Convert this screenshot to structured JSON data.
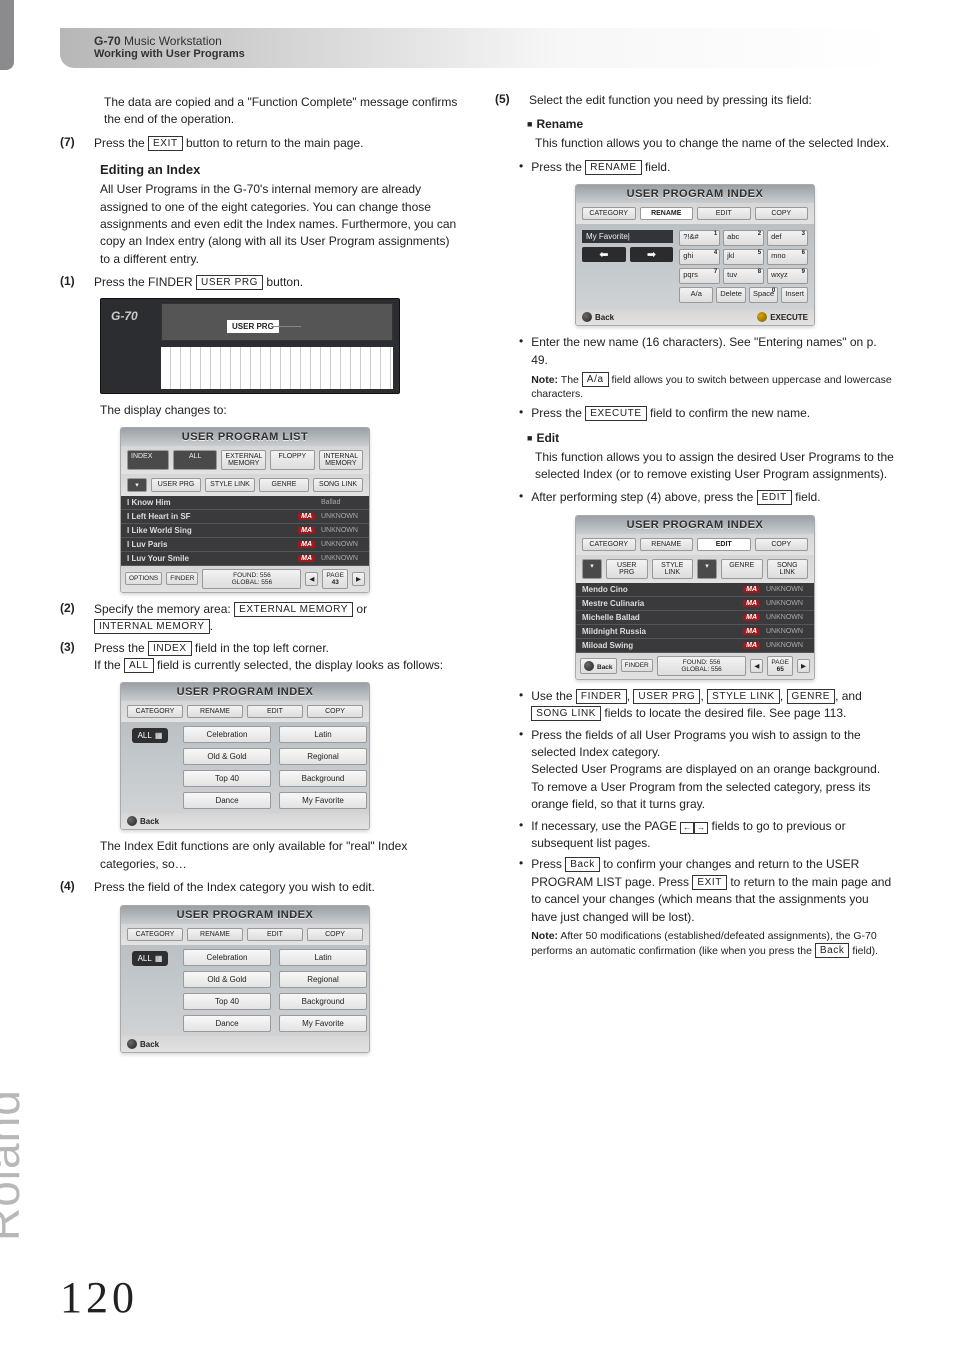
{
  "header": {
    "product_bold": "G-70",
    "product_rest": " Music Workstation",
    "subtitle": "Working with User Programs"
  },
  "brand": "Roland",
  "page_number": "120",
  "figs": {
    "device": {
      "callout": "USER PRG",
      "model": "G-70"
    },
    "list": {
      "title": "USER PROGRAM LIST",
      "top_tabs": [
        "ALL",
        "EXTERNAL MEMORY",
        "FLOPPY",
        "INTERNAL MEMORY"
      ],
      "sort_tabs": [
        "USER PRG",
        "STYLE LINK",
        "GENRE",
        "SONG LINK"
      ],
      "rows": [
        "I Know Him",
        "I Left Heart in SF",
        "I Like World Sing",
        "I Luv Paris",
        "I Luv Your Smile"
      ],
      "row_meta": "UNKNOWN",
      "row_meta0": "Ballad",
      "foot": [
        "OPTIONS",
        "FINDER",
        "FOUND: 556",
        "GLOBAL: 556"
      ],
      "page_label": "PAGE",
      "page_num": "43"
    },
    "index": {
      "title": "USER PROGRAM INDEX",
      "tabs": [
        "CATEGORY",
        "RENAME",
        "EDIT",
        "COPY"
      ],
      "all": "ALL",
      "cells": [
        "Celebration",
        "Latin",
        "Old & Gold",
        "Regional",
        "Top 40",
        "Background",
        "Dance",
        "My Favorite"
      ],
      "back": "Back"
    },
    "rename": {
      "title": "USER PROGRAM INDEX",
      "tabs": [
        "CATEGORY",
        "RENAME",
        "EDIT",
        "COPY"
      ],
      "field": "My   Favorite|",
      "keys": [
        "?!&# 1",
        "abc 2",
        "def 3",
        "ghi 4",
        "jkl 5",
        "mno 6",
        "pqrs 7",
        "tuv 8",
        "wxyz 9",
        "Delete",
        "Space 0",
        "Insert"
      ],
      "aa": "A/a",
      "back": "Back",
      "execute": "EXECUTE"
    },
    "edit": {
      "title": "USER PROGRAM INDEX",
      "tabs": [
        "CATEGORY",
        "RENAME",
        "EDIT",
        "COPY"
      ],
      "sort_tabs": [
        "USER PRG",
        "STYLE LINK",
        "GENRE",
        "SONG LINK"
      ],
      "rows": [
        "Mendo Cino",
        "Mestre Culinaria",
        "Michelle Ballad",
        "Mildnight Russia",
        "Miload Swing"
      ],
      "row_meta": "UNKNOWN",
      "foot": [
        "Back",
        "FINDER",
        "FOUND: 556",
        "GLOBAL: 556"
      ],
      "page_label": "PAGE",
      "page_num": "65"
    }
  },
  "left": {
    "p1": "The data are copied and a \"Function Complete\" message confirms the end of the operation.",
    "s7_num": "(7)",
    "s7a": "Press the ",
    "s7_btn": "EXIT",
    "s7b": " button to return to the main page.",
    "h_editing": "Editing an Index",
    "p2": "All User Programs in the G-70's internal memory are already assigned to one of the eight categories. You can change those assignments and even edit the Index names. Furthermore, you can copy an Index entry (along with all its User Program assignments) to a different entry.",
    "s1_num": "(1)",
    "s1a": "Press the FINDER ",
    "s1_btn": "USER PRG",
    "s1b": " button.",
    "p3": "The display changes to:",
    "s2_num": "(2)",
    "s2a": "Specify the memory area: ",
    "s2_btn1": "EXTERNAL MEMORY",
    "s2_mid": " or ",
    "s2_btn2": "INTERNAL MEMORY",
    "s2_end": ".",
    "s3_num": "(3)",
    "s3a": "Press the ",
    "s3_btn": "INDEX",
    "s3b": " field in the top left corner.",
    "s3c_a": "If the ",
    "s3c_btn": "ALL",
    "s3c_b": " field is currently selected, the display looks as follows:",
    "p4": "The Index Edit functions are only available for \"real\" Index categories, so…",
    "s4_num": "(4)",
    "s4": "Press the field of the Index category you wish to edit."
  },
  "right": {
    "s5_num": "(5)",
    "s5": "Select the edit function you need by pressing its field:",
    "h_rename": "Rename",
    "p_rename": "This function allows you to change the name of the selected Index.",
    "b_rename_a": "Press the ",
    "b_rename_btn": "RENAME",
    "b_rename_b": " field.",
    "b_enter": "Enter the new name (16 characters). See \"Entering names\" on p. 49.",
    "note1_label": "Note:",
    "note1_a": " The ",
    "note1_btn": "A/a",
    "note1_b": " field allows you to switch between uppercase and lowercase characters.",
    "b_exec_a": "Press the ",
    "b_exec_btn": "EXECUTE",
    "b_exec_b": " field to confirm the new name.",
    "h_edit": "Edit",
    "p_edit": "This function allows you to assign the desired User Programs to the selected Index (or to remove existing User Program assignments).",
    "b_edit_a": "After performing step (4) above, press the ",
    "b_edit_btn": "EDIT",
    "b_edit_b": " field.",
    "b_use_a": "Use the ",
    "b_use_b1": "FINDER",
    "b_use_c": ", ",
    "b_use_b2": "USER PRG",
    "b_use_d": ", ",
    "b_use_b3": "STYLE LINK",
    "b_use_e": ", ",
    "b_use_b4": "GENRE",
    "b_use_f": ", and ",
    "b_use_b5": "SONG LINK",
    "b_use_g": " fields to locate the desired file. See page 113.",
    "b_press": "Press the fields of all User Programs you wish to assign to the selected Index category.",
    "b_press2": "Selected User Programs are displayed on an orange background.",
    "b_remove": "To remove a User Program from the selected category, press its orange field, so that it turns gray.",
    "b_page_a": "If necessary, use the PAGE ",
    "b_page_b": " fields to go to previous or subsequent list pages.",
    "b_back_a": "Press ",
    "b_back_btn": "Back",
    "b_back_b": " to confirm your changes and return to the USER PROGRAM LIST page. Press ",
    "b_back_btn2": "EXIT",
    "b_back_c": " to return to the main page and to cancel your changes (which means that the assignments you have just changed will be lost).",
    "note2_label": "Note:",
    "note2_a": " After 50 modifications (established/defeated assignments), the G-70 performs an automatic confirmation (like when you press the ",
    "note2_btn": "Back",
    "note2_b": " field)."
  }
}
